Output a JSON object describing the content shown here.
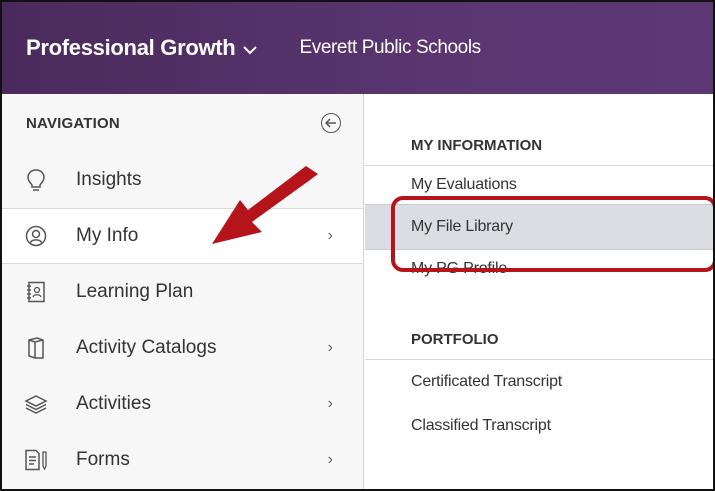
{
  "header": {
    "product": "Professional Growth",
    "product_chevron": "⌄",
    "organization": "Everett Public Schools"
  },
  "sidebar": {
    "title": "NAVIGATION",
    "collapse_icon": "arrow-left-circle-icon",
    "items": [
      {
        "label": "Insights",
        "icon": "lightbulb-icon",
        "has_arrow": false
      },
      {
        "label": "My Info",
        "icon": "user-circle-icon",
        "has_arrow": true,
        "active": true
      },
      {
        "label": "Learning Plan",
        "icon": "contact-book-icon",
        "has_arrow": false
      },
      {
        "label": "Activity Catalogs",
        "icon": "book-icon",
        "has_arrow": true
      },
      {
        "label": "Activities",
        "icon": "layers-icon",
        "has_arrow": true
      },
      {
        "label": "Forms",
        "icon": "form-icon",
        "has_arrow": true
      }
    ],
    "arrow_glyph": "›"
  },
  "content": {
    "sections": [
      {
        "title": "MY INFORMATION",
        "links": [
          "My Evaluations",
          "My File Library",
          "My PG Profile"
        ],
        "selected": "My File Library"
      },
      {
        "title": "PORTFOLIO",
        "links": [
          "Certificated Transcript",
          "Classified Transcript"
        ]
      }
    ]
  },
  "colors": {
    "header_bg": "#4a2a5c",
    "annotation_red": "#b5141b",
    "selected_bg": "#dcdde3"
  }
}
